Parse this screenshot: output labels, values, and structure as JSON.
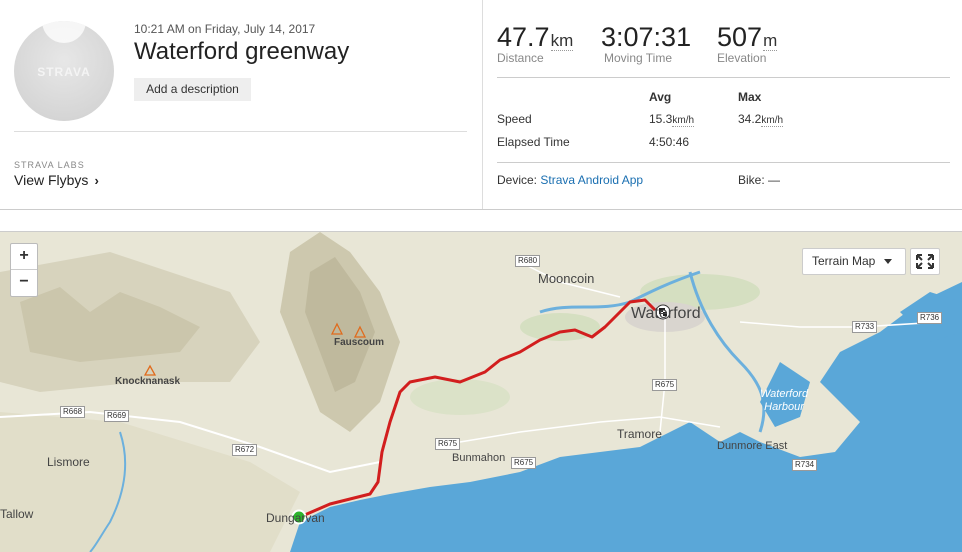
{
  "activity": {
    "datetime": "10:21 AM on Friday, July 14, 2017",
    "title": "Waterford greenway",
    "add_description_label": "Add a description",
    "avatar_logo": "STRAVA"
  },
  "labs": {
    "heading": "STRAVA LABS",
    "link_label": "View Flybys"
  },
  "stats": {
    "distance": {
      "value": "47.7",
      "unit": "km",
      "label": "Distance"
    },
    "moving_time": {
      "value": "3:07:31",
      "label": "Moving Time"
    },
    "elevation": {
      "value": "507",
      "unit": "m",
      "label": "Elevation"
    }
  },
  "more_stats": {
    "headers": {
      "avg": "Avg",
      "max": "Max"
    },
    "speed": {
      "label": "Speed",
      "avg": "15.3",
      "max": "34.2",
      "unit": "km/h"
    },
    "elapsed": {
      "label": "Elapsed Time",
      "avg": "4:50:46"
    }
  },
  "device": {
    "label": "Device:",
    "value": "Strava Android App"
  },
  "bike": {
    "label": "Bike:",
    "value": "—"
  },
  "map": {
    "terrain_label": "Terrain Map",
    "zoom_in": "+",
    "zoom_out": "−",
    "places": {
      "waterford": "Waterford",
      "mooncoin": "Mooncoin",
      "fauscoum": "Fauscoum",
      "knocknanask": "Knocknanask",
      "tramore": "Tramore",
      "dunmore_east": "Dunmore East",
      "bunmahon": "Bunmahon",
      "lismore": "Lismore",
      "tallow": "Tallow",
      "dungarvan": "Dungarvan",
      "harbour": "Waterford\nHarbour"
    },
    "roads": {
      "r680": "R680",
      "r733": "R733",
      "r736": "R736",
      "r675a": "R675",
      "r675b": "R675",
      "r675c": "R675",
      "r668": "R668",
      "r669": "R669",
      "r672": "R672",
      "r734": "R734"
    },
    "colors": {
      "route": "#d21e1e",
      "sea": "#5aa7d8",
      "land": "#e8e6d6",
      "start": "#2db52d"
    }
  }
}
